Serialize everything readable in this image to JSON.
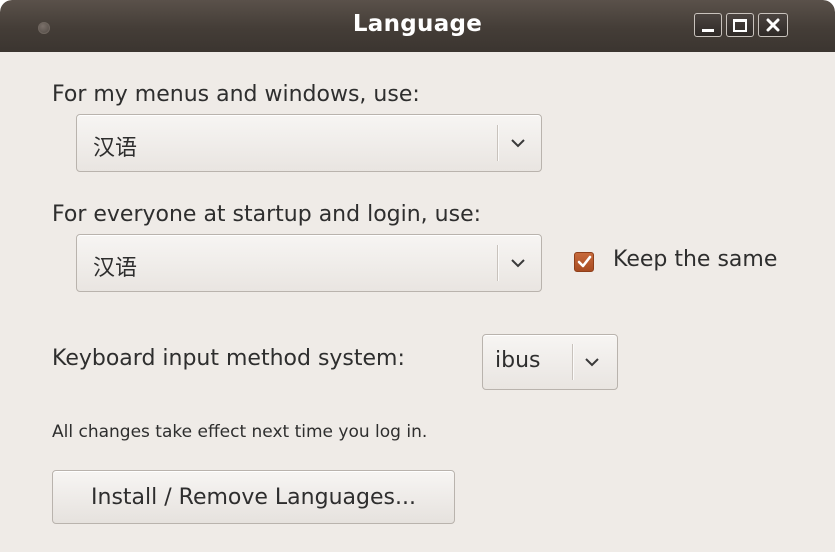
{
  "window": {
    "title": "Language"
  },
  "menus_language": {
    "label": "For my menus and windows, use:",
    "selected": "汉语"
  },
  "startup_language": {
    "label": "For everyone at startup and login, use:",
    "selected": "汉语",
    "keep_same_label": "Keep the same",
    "keep_same_checked": true
  },
  "input_method": {
    "label": "Keyboard input method system:",
    "selected": "ibus"
  },
  "note": "All changes take effect next time you log in.",
  "install_button_label": "Install / Remove Languages...",
  "colors": {
    "titlebar": "#443d37",
    "window_bg": "#efebe7",
    "checkbox_accent": "#b85428"
  },
  "icons": {
    "window_menu": "circle-dot-icon",
    "minimize": "minimize-icon",
    "maximize": "maximize-icon",
    "close": "close-icon",
    "dropdown": "chevron-down-icon",
    "check": "checkmark-icon"
  }
}
